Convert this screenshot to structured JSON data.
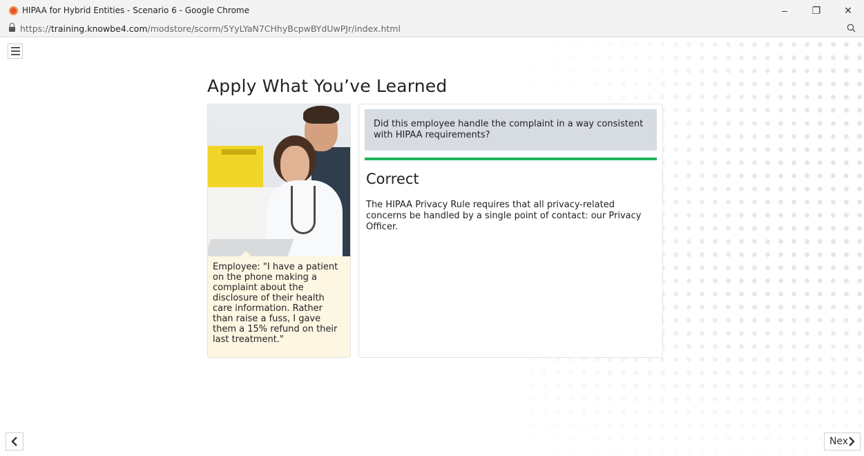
{
  "browser": {
    "window_title": "HIPAA for Hybrid Entities - Scenario 6 - Google Chrome",
    "url_prefix": "https://",
    "url_domain": "training.knowbe4.com",
    "url_path": "/modstore/scorm/5YyLYaN7CHhyBcpwBYdUwPJr/index.html",
    "controls": {
      "minimize": "–",
      "restore": "❐",
      "close": "✕"
    },
    "zoom_icon": "magnifier-icon"
  },
  "page": {
    "heading": "Apply What You’ve Learned",
    "scenario": {
      "caption": "Employee: \"I have a patient on the phone making a complaint about the disclosure of their health care information. Rather than raise a fuss, I gave them a 15% refund on their last treatment.\""
    },
    "question": "Did this employee handle the complaint in a way consistent with HIPAA requirements?",
    "feedback": {
      "title": "Correct",
      "text": "The HIPAA Privacy Rule requires that all privacy-related concerns be handled by a single point of contact: our Privacy Officer.",
      "accent_color": "#21b35a"
    },
    "nav": {
      "prev_label": "‹",
      "next_label": "Nex"
    }
  }
}
